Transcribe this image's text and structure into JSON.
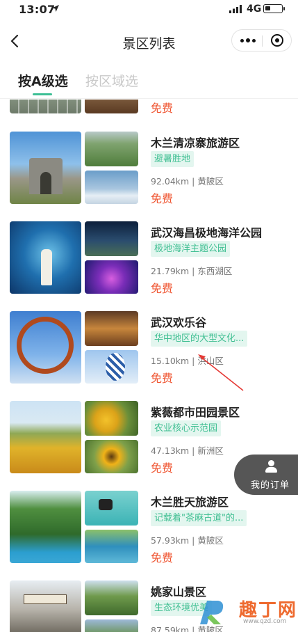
{
  "status_bar": {
    "time": "13:07",
    "network": "4G"
  },
  "nav": {
    "title": "景区列表"
  },
  "tabs": [
    {
      "label": "按A级选",
      "active": true
    },
    {
      "label": "按区域选",
      "active": false
    }
  ],
  "partial_item": {
    "price": "免费"
  },
  "items": [
    {
      "name": "木兰清凉寨旅游区",
      "tag": "避暑胜地",
      "meta": "92.04km | 黄陂区",
      "price": "免费"
    },
    {
      "name": "武汉海昌极地海洋公园",
      "tag": "极地海洋主题公园",
      "meta": "21.79km | 东西湖区",
      "price": "免费"
    },
    {
      "name": "武汉欢乐谷",
      "tag": "华中地区的大型文化...",
      "meta": "15.10km | 洪山区",
      "price": "免费"
    },
    {
      "name": "紫薇都市田园景区",
      "tag": "农业核心示范园",
      "meta": "47.13km | 新洲区",
      "price": "免费"
    },
    {
      "name": "木兰胜天旅游区",
      "tag": "记载着\"茶麻古道\"的...",
      "meta": "57.93km | 黄陂区",
      "price": "免费"
    },
    {
      "name": "姚家山景区",
      "tag": "生态环境优美",
      "meta": "87.59km | 黄陂区",
      "price": ""
    }
  ],
  "float_button": {
    "label": "我的订单"
  },
  "watermark": {
    "text": "趣丁网",
    "url": "www.qzd.com"
  },
  "colors": {
    "accent": "#3dbf95",
    "price": "#ef5430",
    "tag_bg": "#e3f6ef",
    "annotation": "#e53935"
  }
}
